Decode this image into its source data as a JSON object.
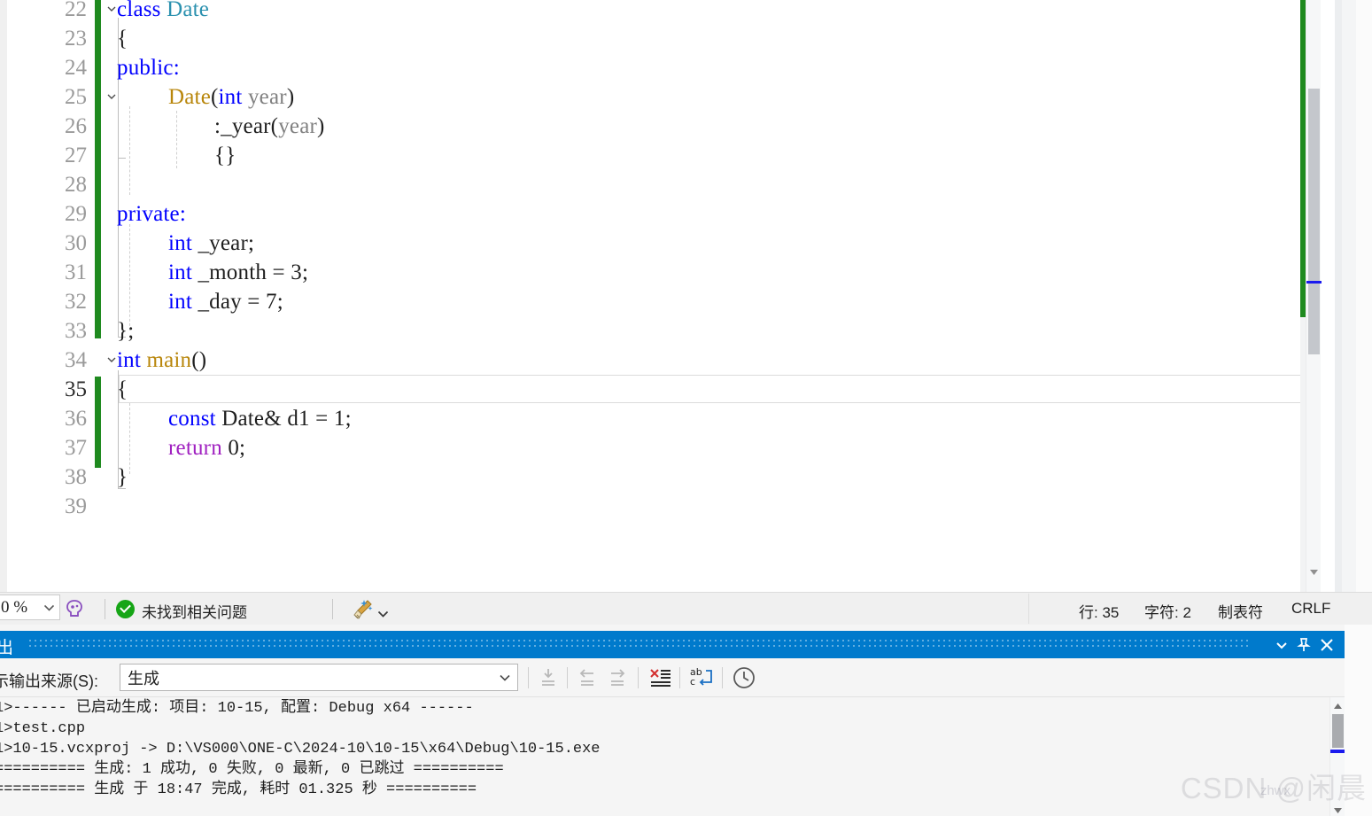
{
  "editor": {
    "first_line": 22,
    "current_line": 35,
    "lines": [
      {
        "n": 22,
        "indent": 0,
        "tokens": [
          {
            "t": "class",
            "c": "kw"
          },
          {
            "t": " ",
            "c": "plain"
          },
          {
            "t": "Date",
            "c": "type"
          }
        ]
      },
      {
        "n": 23,
        "indent": 0,
        "tokens": [
          {
            "t": "{",
            "c": "plain"
          }
        ]
      },
      {
        "n": 24,
        "indent": 0,
        "tokens": [
          {
            "t": "public",
            "c": "kw"
          },
          {
            "t": ":",
            "c": "kw"
          }
        ]
      },
      {
        "n": 25,
        "indent": 1,
        "tokens": [
          {
            "t": "Date",
            "c": "ctor"
          },
          {
            "t": "(",
            "c": "plain"
          },
          {
            "t": "int",
            "c": "kw"
          },
          {
            "t": " ",
            "c": "plain"
          },
          {
            "t": "year",
            "c": "param"
          },
          {
            "t": ")",
            "c": "plain"
          }
        ]
      },
      {
        "n": 26,
        "indent": 2,
        "tokens": [
          {
            "t": ":_year",
            "c": "plain"
          },
          {
            "t": "(",
            "c": "plain"
          },
          {
            "t": "year",
            "c": "param"
          },
          {
            "t": ")",
            "c": "plain"
          }
        ]
      },
      {
        "n": 27,
        "indent": 2,
        "tokens": [
          {
            "t": "{}",
            "c": "plain"
          }
        ]
      },
      {
        "n": 28,
        "indent": 0,
        "tokens": []
      },
      {
        "n": 29,
        "indent": 0,
        "tokens": [
          {
            "t": "private",
            "c": "kw"
          },
          {
            "t": ":",
            "c": "kw"
          }
        ]
      },
      {
        "n": 30,
        "indent": 1,
        "tokens": [
          {
            "t": "int",
            "c": "kw"
          },
          {
            "t": " _year;",
            "c": "plain"
          }
        ]
      },
      {
        "n": 31,
        "indent": 1,
        "tokens": [
          {
            "t": "int",
            "c": "kw"
          },
          {
            "t": " _month = 3;",
            "c": "plain"
          }
        ]
      },
      {
        "n": 32,
        "indent": 1,
        "tokens": [
          {
            "t": "int",
            "c": "kw"
          },
          {
            "t": " _day = 7;",
            "c": "plain"
          }
        ]
      },
      {
        "n": 33,
        "indent": 0,
        "tokens": [
          {
            "t": "};",
            "c": "plain"
          }
        ]
      },
      {
        "n": 34,
        "indent": 0,
        "tokens": [
          {
            "t": "int",
            "c": "kw"
          },
          {
            "t": " ",
            "c": "plain"
          },
          {
            "t": "main",
            "c": "ctor"
          },
          {
            "t": "()",
            "c": "plain"
          }
        ]
      },
      {
        "n": 35,
        "indent": 0,
        "tokens": [
          {
            "t": "{",
            "c": "plain"
          }
        ]
      },
      {
        "n": 36,
        "indent": 1,
        "tokens": [
          {
            "t": "const",
            "c": "kw"
          },
          {
            "t": " Date& d1 = 1;",
            "c": "plain"
          }
        ]
      },
      {
        "n": 37,
        "indent": 1,
        "tokens": [
          {
            "t": "return",
            "c": "ctl"
          },
          {
            "t": " 0;",
            "c": "plain"
          }
        ]
      },
      {
        "n": 38,
        "indent": 0,
        "tokens": [
          {
            "t": "}",
            "c": "plain"
          }
        ]
      },
      {
        "n": 39,
        "indent": 0,
        "tokens": []
      }
    ]
  },
  "statusbar": {
    "zoom_value": "0 %",
    "zoom_icon": "chevron-down-icon",
    "intellicode_icon": "intellicode-icon",
    "status_icon": "check-circle-icon",
    "status_text": "未找到相关问题",
    "broom_icon": "code-cleanup-broom-icon",
    "broom_caret_icon": "chevron-down-icon",
    "line_label": "行: 35",
    "char_label": "字符: 2",
    "tab_label": "制表符",
    "eol_label": "CRLF"
  },
  "output": {
    "title": "出",
    "header_dropdown_icon": "chevron-down-icon",
    "header_pin_icon": "pin-icon",
    "header_close_icon": "close-icon",
    "source_label": "示输出来源(S):",
    "source_value": "生成",
    "source_caret_icon": "chevron-down-icon",
    "toolbar_icons": [
      "go-to-message-icon",
      "navigate-back-icon",
      "navigate-forward-icon",
      "clear-all-icon",
      "word-wrap-icon",
      "history-icon"
    ],
    "lines": [
      "1>------ 已启动生成: 项目: 10-15, 配置: Debug x64 ------",
      "1>test.cpp",
      "1>10-15.vcxproj -> D:\\VS000\\ONE-C\\2024-10\\10-15\\x64\\Debug\\10-15.exe",
      "========== 生成: 1 成功, 0 失败, 0 最新, 0 已跳过 ==========",
      "========== 生成 于 18:47 完成, 耗时 01.325 秒 =========="
    ],
    "scroll_up_icon": "triangle-up-icon",
    "scroll_down_icon": "triangle-down-icon"
  },
  "watermark": {
    "text": "CSDN @闲晨",
    "sub": "zhwx"
  },
  "colors": {
    "keyword": "#0000ff",
    "type": "#2b91af",
    "control": "#a020c0",
    "parameter": "#808080",
    "changebar": "#1f8a1f",
    "panel_header": "#007acc",
    "cursor_marker": "#1a1aee",
    "status_ok": "#16a516"
  }
}
